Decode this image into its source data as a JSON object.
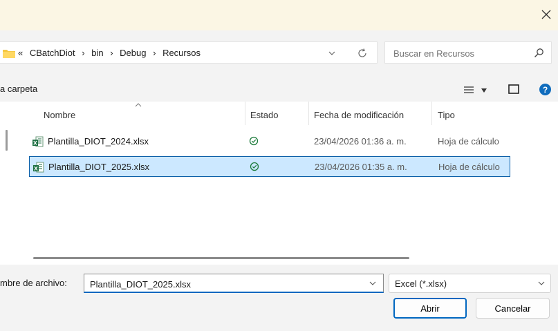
{
  "address": {
    "overflow": "«",
    "crumbs": [
      "CBatchDiot",
      "bin",
      "Debug",
      "Recursos"
    ],
    "separator": "›"
  },
  "search": {
    "placeholder": "Buscar en Recursos"
  },
  "toolbar": {
    "new_folder_partial": "a carpeta"
  },
  "columns": {
    "name": "Nombre",
    "state": "Estado",
    "date": "Fecha de modificación",
    "type": "Tipo"
  },
  "files": [
    {
      "name": "Plantilla_DIOT_2024.xlsx",
      "date": "23/04/2026 01:36 a. m.",
      "type": "Hoja de cálculo",
      "selected": false
    },
    {
      "name": "Plantilla_DIOT_2025.xlsx",
      "date": "23/04/2026 01:35 a. m.",
      "type": "Hoja de cálculo",
      "selected": true
    }
  ],
  "bottom": {
    "filename_label": "mbre de archivo:",
    "filename_value": "Plantilla_DIOT_2025.xlsx",
    "filter_value": "Excel  (*.xlsx)",
    "open_label": "Abrir",
    "cancel_label": "Cancelar"
  },
  "colors": {
    "accent": "#0067c0",
    "selection": "#cce8ff",
    "titlebar": "#fbf6e4",
    "sync_green": "#1b7a3a",
    "folder_yellow": "#f5c842",
    "excel_green": "#1d6f42"
  },
  "icons": [
    "close-icon",
    "folder-icon",
    "chevron-down-icon",
    "refresh-icon",
    "search-icon",
    "view-list-icon",
    "preview-pane-icon",
    "help-icon",
    "excel-file-icon",
    "sync-status-icon"
  ]
}
